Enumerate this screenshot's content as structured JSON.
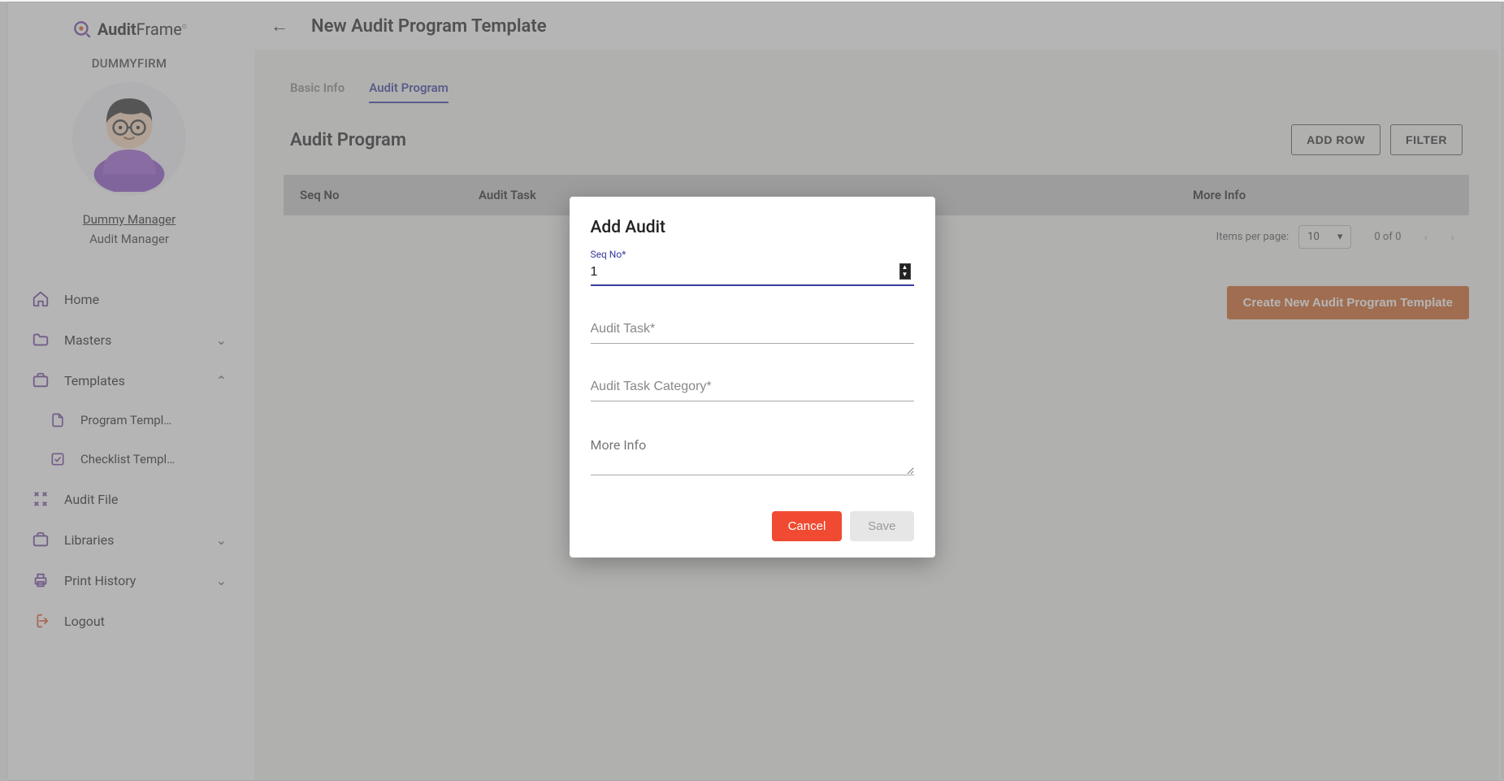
{
  "brand": {
    "name_bold": "Audit",
    "name_thin": "Frame",
    "sup": "©"
  },
  "firm": "DUMMYFIRM",
  "user": {
    "name": "Dummy Manager",
    "role": "Audit Manager"
  },
  "nav": {
    "home": "Home",
    "masters": "Masters",
    "templates": "Templates",
    "program_tpl": "Program Templ…",
    "checklist_tpl": "Checklist Templ…",
    "audit_file": "Audit File",
    "libraries": "Libraries",
    "print_history": "Print History",
    "logout": "Logout"
  },
  "header": {
    "title": "New Audit Program Template"
  },
  "tabs": {
    "basic": "Basic Info",
    "program": "Audit Program"
  },
  "section": {
    "title": "Audit Program",
    "add_row": "ADD ROW",
    "filter": "FILTER"
  },
  "table": {
    "col_seq": "Seq No",
    "col_task": "Audit Task",
    "col_more": "More Info"
  },
  "paginator": {
    "items_label": "Items per page:",
    "page_size": "10",
    "range": "0 of 0"
  },
  "create_btn": "Create New Audit Program Template",
  "modal": {
    "title": "Add Audit",
    "seq_label": "Seq No*",
    "seq_value": "1",
    "task_placeholder": "Audit Task*",
    "category_placeholder": "Audit Task Category*",
    "more_info_placeholder": "More Info",
    "cancel": "Cancel",
    "save": "Save"
  }
}
